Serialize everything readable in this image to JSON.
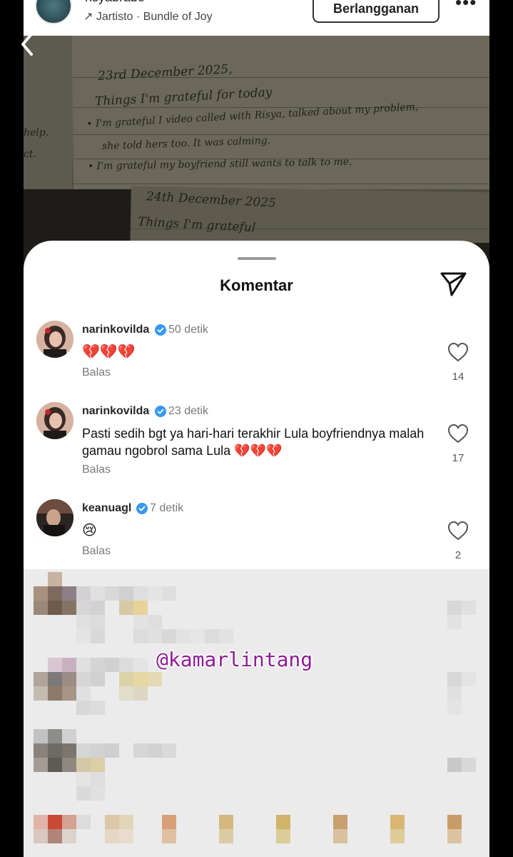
{
  "reel": {
    "username": "risyabrabo",
    "music": "Jartisto · Bundle of Joy",
    "subscribe_label": "Berlangganan",
    "more_icon": "more-horizontal-icon",
    "back_icon": "chevron-left-icon",
    "notebook_lines": [
      "23rd December 2025,",
      "Things I'm grateful for today",
      "• I'm grateful I video called with Risya, talked about my problem,",
      "she told hers too. It was calming.",
      "• I'm grateful my boyfriend still wants to talk to me.",
      "24th December 2025",
      "Things I'm grateful"
    ],
    "margin_words": [
      "help.",
      "ct."
    ]
  },
  "sheet": {
    "title": "Komentar",
    "share_icon": "send-icon",
    "comments": [
      {
        "username": "narinkovilda",
        "time": "50 detik",
        "text": "💔💔💔",
        "reply_label": "Balas",
        "likes": "14"
      },
      {
        "username": "narinkovilda",
        "time": "23 detik",
        "text": "Pasti sedih bgt ya hari-hari terakhir Lula boyfriendnya malah gamau ngobrol sama Lula 💔💔💔",
        "reply_label": "Balas",
        "likes": "17"
      },
      {
        "username": "keanuagl",
        "time": "7 detik",
        "text": "😢",
        "reply_label": "Balas",
        "likes": "2"
      }
    ],
    "watermark": "@kamarlintang"
  },
  "colors": {
    "verified": "#3897f0",
    "watermark": "#8e1c96",
    "sheet_bg": "#ffffff",
    "muted_text": "#7a7a7a"
  }
}
